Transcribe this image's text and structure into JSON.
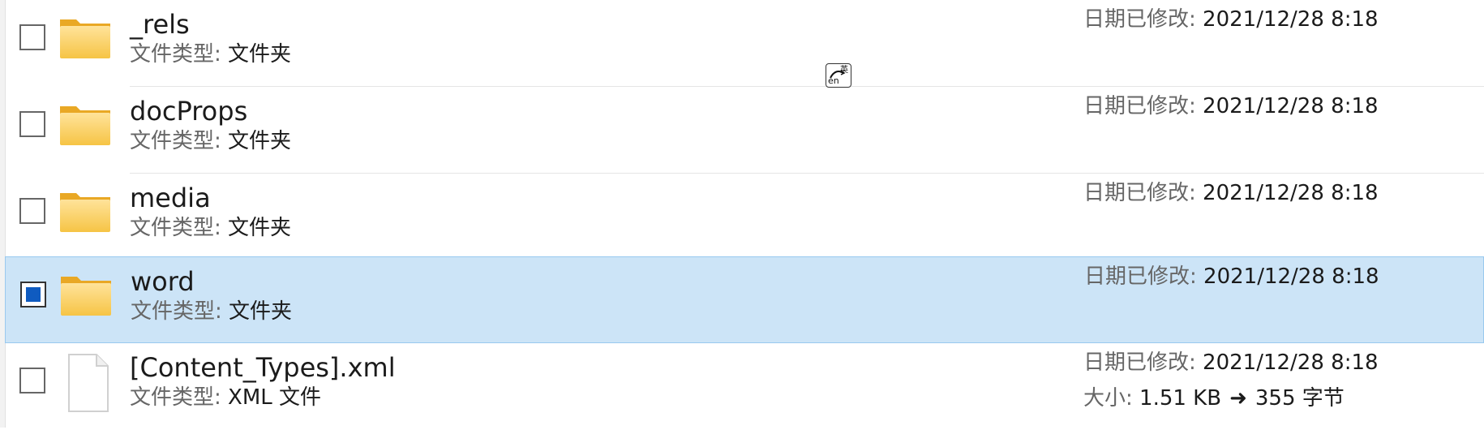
{
  "labels": {
    "file_type": "文件类型: ",
    "date_modified": "日期已修改: ",
    "size": "大小: "
  },
  "rows": [
    {
      "name": "_rels",
      "type": "文件夹",
      "date": "2021/12/28 8:18",
      "icon": "folder-icon",
      "selected": false
    },
    {
      "name": "docProps",
      "type": "文件夹",
      "date": "2021/12/28 8:18",
      "icon": "folder-icon",
      "selected": false
    },
    {
      "name": "media",
      "type": "文件夹",
      "date": "2021/12/28 8:18",
      "icon": "folder-icon",
      "selected": false
    },
    {
      "name": "word",
      "type": "文件夹",
      "date": "2021/12/28 8:18",
      "icon": "folder-icon",
      "selected": true
    },
    {
      "name": "[Content_Types].xml",
      "type": "XML 文件",
      "date": "2021/12/28 8:18",
      "icon": "file-icon",
      "selected": false,
      "size_from": "1.51 KB",
      "size_to": "355 字节"
    }
  ],
  "ime": {
    "en": "en",
    "zh": "英",
    "icon": "ime-indicator-icon"
  },
  "colors": {
    "selected_bg": "#cce4f7",
    "selected_border": "#99c9ef",
    "check_fill": "#0f5bc0"
  }
}
